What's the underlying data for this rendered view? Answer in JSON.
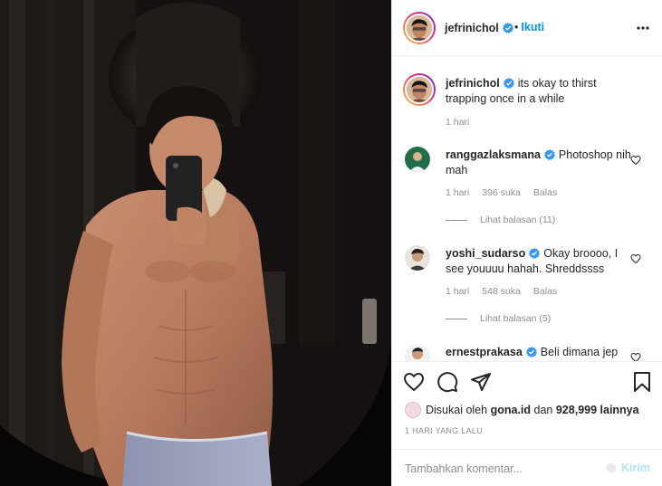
{
  "post": {
    "username": "jefrinichol",
    "follow_dot": "•",
    "follow_label": "Ikuti",
    "caption_user": "jefrinichol",
    "caption_text": "its okay to thirst trapping once in a while",
    "caption_age": "1 hari"
  },
  "comments": [
    {
      "user": "ranggazlaksmana",
      "text": "Photoshop nih mah",
      "age": "1 hari",
      "likes": "396 suka",
      "reply_label": "Balas",
      "replies_label": "Lihat balasan (11)"
    },
    {
      "user": "yoshi_sudarso",
      "text": "Okay broooo, I see youuuu hahah. Shreddssss",
      "age": "1 hari",
      "likes": "548 suka",
      "reply_label": "Balas",
      "replies_label": "Lihat balasan (5)"
    },
    {
      "user": "ernestprakasa",
      "text": "Beli dimana jep"
    }
  ],
  "likes": {
    "prefix": "Disukai oleh",
    "user": "gona.id",
    "joiner": "dan",
    "count": "928,999 lainnya"
  },
  "timestamp": "1 HARI YANG LALU",
  "composer": {
    "placeholder": "Tambahkan komentar...",
    "send_label": "Kirim"
  },
  "icons": {
    "header": [
      "verified-badge-icon",
      "more-options-icon"
    ],
    "actions": [
      "heart-icon",
      "comment-icon",
      "share-icon",
      "bookmark-icon"
    ]
  },
  "colors": {
    "link_blue": "#0095f6",
    "secondary_text": "#8e8e8e",
    "primary_text": "#262626",
    "send_disabled": "#b2dffc",
    "border": "#efefef"
  }
}
